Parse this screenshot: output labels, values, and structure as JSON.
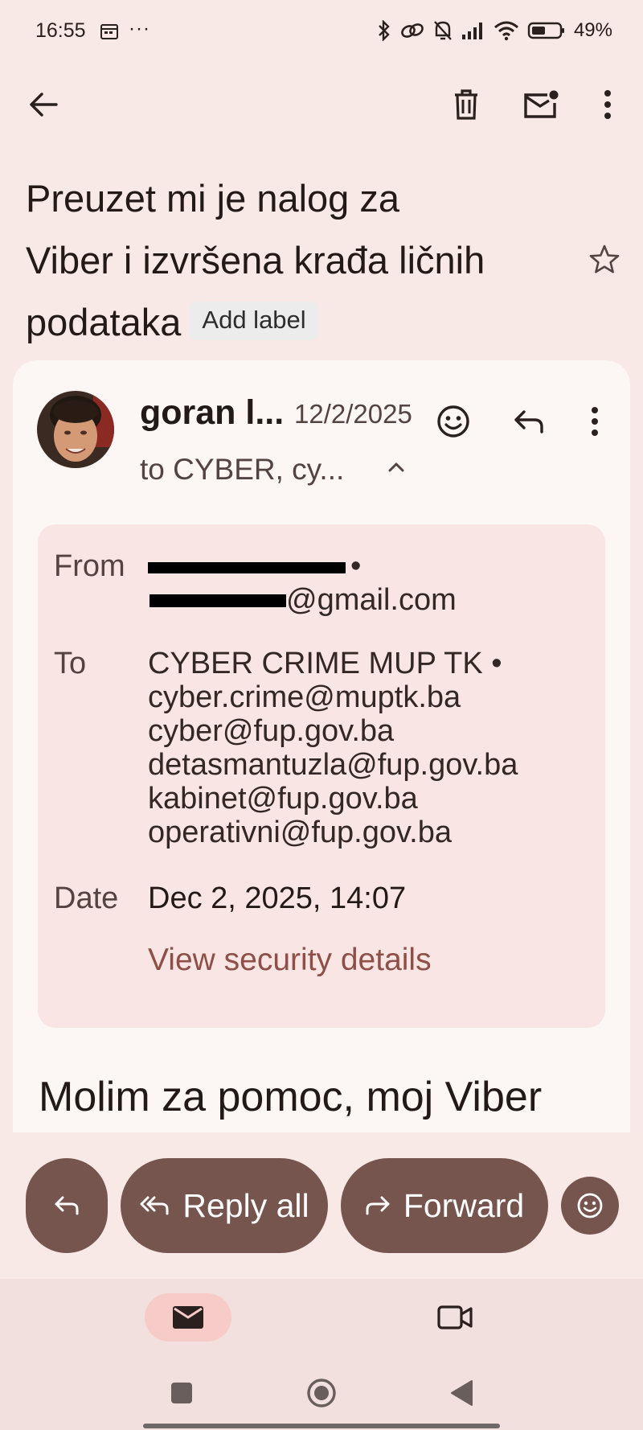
{
  "status_bar": {
    "time": "16:55",
    "battery": "49%",
    "dots": "···"
  },
  "toolbar": {
    "back_icon": "arrow-back-icon",
    "delete_icon": "trash-icon",
    "mark_unread_icon": "mail-unread-icon",
    "more_icon": "more-vert-icon"
  },
  "subject": {
    "line1": "Preuzet mi je nalog za",
    "line2": "Viber i izvršena krađa ličnih",
    "line3": "podataka",
    "add_label": "Add label"
  },
  "message": {
    "sender": "goran l...",
    "date": "12/2/2025",
    "to_summary": "to CYBER, cy...",
    "body_preview": "Molim za pomoc, moj Viber"
  },
  "details": {
    "from_label": "From",
    "from_name_suffix": "•",
    "from_email_suffix": "@gmail.com",
    "to_label": "To",
    "to_recipients": [
      "CYBER CRIME MUP TK •",
      "cyber.crime@muptk.ba",
      "cyber@fup.gov.ba",
      "detasmantuzla@fup.gov.ba",
      "kabinet@fup.gov.ba",
      "operativni@fup.gov.ba"
    ],
    "date_label": "Date",
    "date_value": "Dec 2, 2025, 14:07",
    "security_link": "View security details"
  },
  "actions": {
    "reply_all": "Reply all",
    "forward": "Forward"
  },
  "colors": {
    "background": "#f8e8e6",
    "card": "#fcf6f5",
    "details_bg": "#f9e6e4",
    "button": "#77554f",
    "link": "#8d4f47",
    "nav_active": "#f7ccc8"
  }
}
